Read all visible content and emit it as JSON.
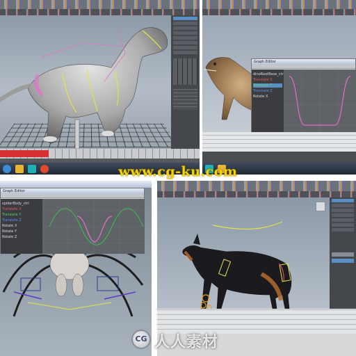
{
  "watermark": {
    "site": "www.cg-ku.com",
    "logo_text": "CG",
    "chinese_text": "人人素材"
  },
  "panels": {
    "top_left": {
      "subject": "dinosaur-model",
      "channel_items": [
        "IMAGEVIS",
        "dinoRootBase_ctrl",
        "dinoBody_ctrl",
        "dinoHead_ctrl",
        "dinoTail_ctrl",
        "dinoNeck_ctrl"
      ]
    },
    "top_right": {
      "subject": "dinosaur-walk-graph-editor",
      "graph_title": "Graph Editor",
      "list_items": [
        "dinoRootBase_ctrl",
        "Translate X",
        "Translate Y",
        "Translate Z",
        "Rotate X"
      ]
    },
    "bottom_left": {
      "subject": "spider-rig-graph-editor",
      "graph_title": "Graph Editor",
      "list_items": [
        "spiderBody_ctrl",
        "Translate X",
        "Translate Y",
        "Translate Z",
        "Rotate X",
        "Rotate Y",
        "Rotate Z"
      ]
    },
    "bottom_right": {
      "subject": "dog-walk-cycle",
      "channel_items": [
        "dog_ctrl",
        "dogRoot_ctrl",
        "dogSpine_ctrl"
      ]
    }
  },
  "colors": {
    "maya_ui": "#3b3e43",
    "viewport_top": "#8d9aa8",
    "curve_green": "#3fbf4f",
    "curve_red": "#d84a4a",
    "curve_pink": "#e071c8",
    "selection_blue": "#5b8fc4",
    "watermark_yellow": "#f3d000"
  }
}
